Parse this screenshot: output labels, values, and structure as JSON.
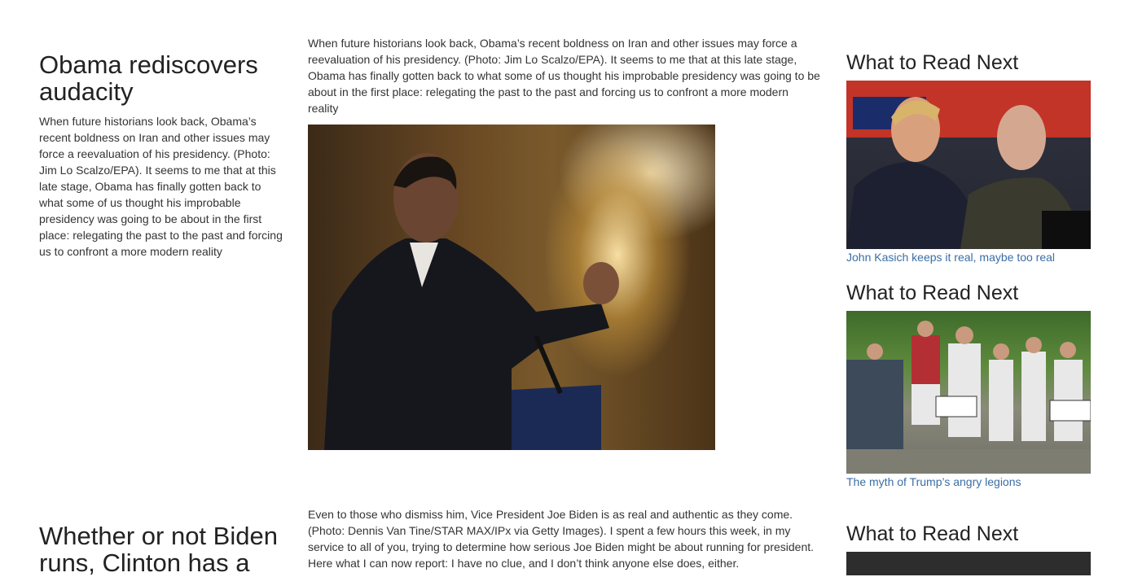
{
  "stories": [
    {
      "headline": "Obama rediscovers audacity",
      "summary": "When future historians look back, Obama’s recent boldness on Iran and other issues may force a reevaluation of his presidency. (Photo: Jim Lo Scalzo/EPA). It seems to me that at this late stage, Obama has finally gotten back to what some of us thought his improbable presidency was going to be about in the first place: relegating the past to the past and forcing us to confront a more modern reality",
      "body": "When future historians look back, Obama’s recent boldness on Iran and other issues may force a reevaluation of his presidency. (Photo: Jim Lo Scalzo/EPA). It seems to me that at this late stage, Obama has finally gotten back to what some of us thought his improbable presidency was going to be about in the first place: relegating the past to the past and forcing us to confront a more modern reality"
    },
    {
      "headline": "Whether or not Biden runs, Clinton has a",
      "body": "Even to those who dismiss him, Vice President Joe Biden is as real and authentic as they come. (Photo: Dennis Van Tine/STAR MAX/IPx via Getty Images). I spent a few hours this week, in my service to all of you, trying to determine how serious Joe Biden might be about running for president. Here what I can now report: I have no clue, and I don’t think anyone else does, either."
    }
  ],
  "read_next": [
    {
      "heading": "What to Read Next",
      "link": "John Kasich keeps it real, maybe too real"
    },
    {
      "heading": "What to Read Next",
      "link": "The myth of Trump’s angry legions"
    },
    {
      "heading": "What to Read Next"
    }
  ],
  "colors": {
    "link": "#3a6ea5",
    "text": "#333333",
    "heading": "#222222"
  },
  "icons": [
    "obama-speech-photo",
    "trump-press-photo",
    "trump-crowd-photo"
  ]
}
